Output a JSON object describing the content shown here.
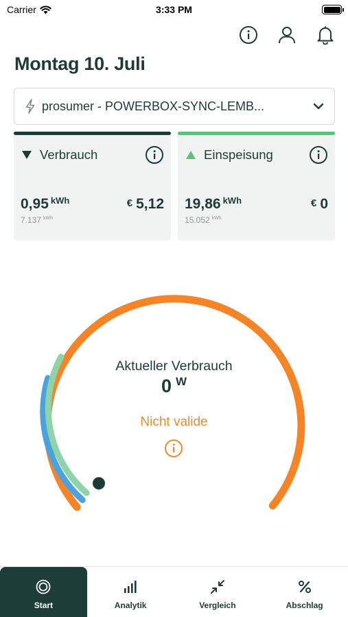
{
  "status_bar": {
    "carrier": "Carrier",
    "time": "3:33 PM"
  },
  "header": {
    "title": "Montag 10. Juli",
    "icons": [
      "info-icon",
      "user-icon",
      "bell-icon"
    ]
  },
  "meter_selector": {
    "icon": "bolt-icon",
    "label": "prosumer - POWERBOX-SYNC-LEMB...",
    "chevron": "chevron-down-icon"
  },
  "cards": {
    "consumption": {
      "title": "Verbrauch",
      "energy": "0,95",
      "energy_unit": "kWh",
      "meter_reading": "7.137",
      "meter_unit": "kWh",
      "currency": "€",
      "amount": "5,12",
      "accent_color": "#1d3b34"
    },
    "feedin": {
      "title": "Einspeisung",
      "energy": "19,86",
      "energy_unit": "kWh",
      "meter_reading": "15.052",
      "meter_unit": "kWh",
      "currency": "€",
      "amount": "0",
      "accent_color": "#5cc27b"
    }
  },
  "gauge": {
    "label": "Aktueller Verbrauch",
    "value": "0",
    "unit": "W",
    "status": "Nicht valide",
    "colors": {
      "outer": "#f58426",
      "mid": "#4aa3df",
      "inner": "#8dd4a8",
      "marker": "#1d3b34"
    }
  },
  "tabbar": {
    "active": "Start",
    "tabs": [
      {
        "label": "Start",
        "icon": "target-icon"
      },
      {
        "label": "Analytik",
        "icon": "bar-chart-icon"
      },
      {
        "label": "Vergleich",
        "icon": "compare-arrows-icon"
      },
      {
        "label": "Abschlag",
        "icon": "percent-icon"
      }
    ]
  }
}
